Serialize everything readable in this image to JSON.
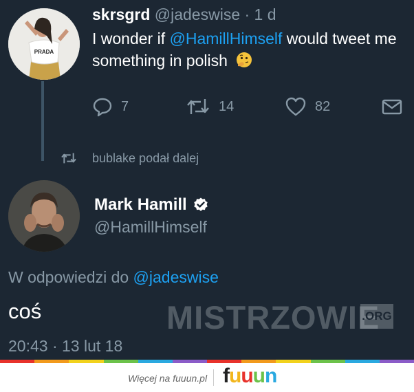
{
  "tweet1": {
    "name": "skrsgrd",
    "meta": " @jadeswise · 1 d",
    "text_prefix": "I wonder if ",
    "mention": "@HamillHimself",
    "text_suffix": " would tweet me something in polish",
    "emoji": "thinking-face",
    "avatar_shirt_text": "PRADA",
    "actions": {
      "reply": "7",
      "retweet": "14",
      "like": "82"
    }
  },
  "retweet_info": {
    "text": "bublake podał dalej"
  },
  "tweet2": {
    "name": "Mark Hamill",
    "handle": "@HamillHimself",
    "reply_prefix": "W odpowiedzi do ",
    "reply_mention": "@jadeswise",
    "text": "coś",
    "time": "20:43 · 13 lut 18"
  },
  "watermark": {
    "text": "MISTRZOWIE",
    "org": ".ORG"
  },
  "footer": {
    "text": "Więcej na fuuun.pl",
    "logo": [
      "f",
      "u",
      "u",
      "u",
      "n"
    ]
  },
  "colors": {
    "background": "#1c2733",
    "accent": "#1da1f2",
    "muted": "#8899a6",
    "stripe": [
      "#e8322b",
      "#f29a1d",
      "#f2d21d",
      "#6cc24a",
      "#2aa9e0",
      "#8b5cc8",
      "#e8322b",
      "#f29a1d",
      "#f2d21d",
      "#6cc24a",
      "#2aa9e0",
      "#8b5cc8"
    ],
    "logo": [
      "#2aa9e0",
      "#f2b61d",
      "#e8322b",
      "#6cc24a",
      "#2aa9e0"
    ]
  }
}
